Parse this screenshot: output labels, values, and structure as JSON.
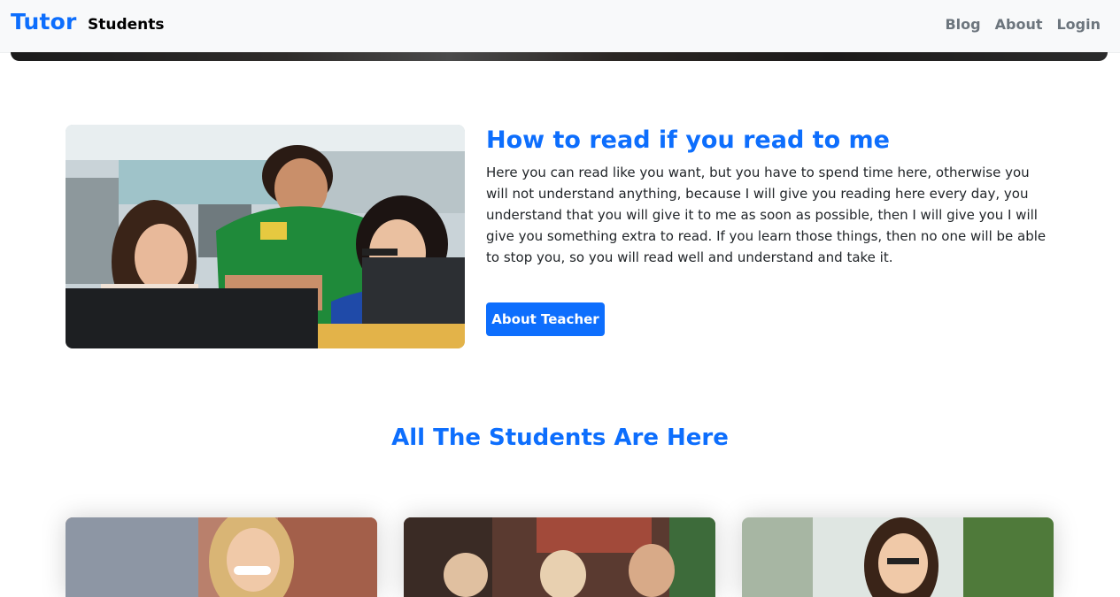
{
  "navbar": {
    "brand": "Tutor",
    "left_link": "Students",
    "right_links": [
      "Blog",
      "About",
      "Login"
    ]
  },
  "about": {
    "image_icon": "classroom-photo",
    "title": "How to read if you read to me",
    "text": "Here you can read like you want, but you have to spend time here, otherwise you will not understand anything, because I will give you reading here every day, you understand that you will give it to me as soon as possible, then I will give you I will give you something extra to read. If you learn those things, then no one will be able to stop you, so you will read well and understand and take it.",
    "button_label": "About Teacher"
  },
  "students": {
    "title": "All The Students Are Here",
    "cards": [
      {
        "image_icon": "student-photo-1"
      },
      {
        "image_icon": "student-photo-2"
      },
      {
        "image_icon": "student-photo-3"
      }
    ]
  },
  "colors": {
    "accent": "#0d6efd",
    "navbar_bg": "#f8f9fa",
    "nav_muted": "#6c757d"
  }
}
